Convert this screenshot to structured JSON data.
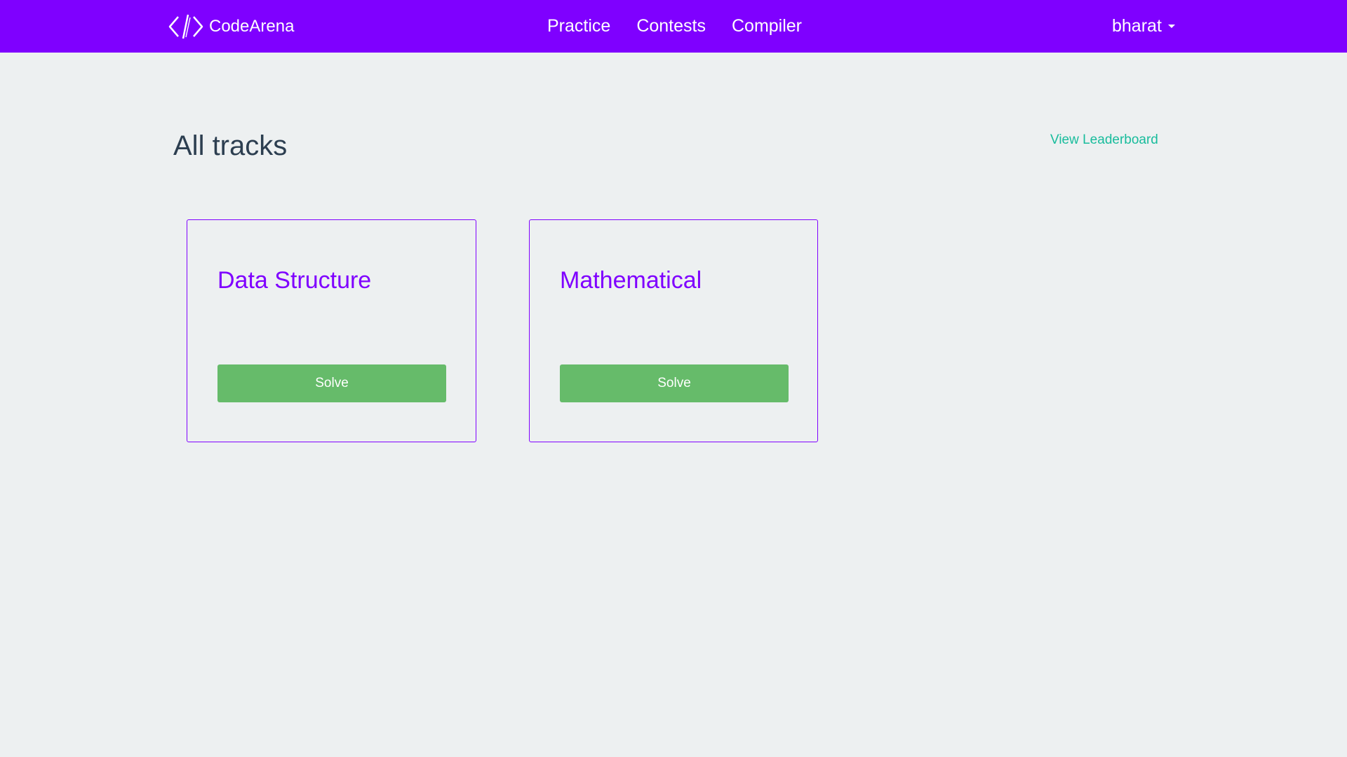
{
  "navbar": {
    "brand_icon": "code-brackets-icon",
    "brand_name": "CodeArena",
    "links": [
      "Practice",
      "Contests",
      "Compiler"
    ],
    "user": "bharat",
    "user_menu_icon": "caret-down-icon",
    "background_color": "#7f00ff"
  },
  "main": {
    "title": "All tracks",
    "leaderboard_link": "View Leaderboard",
    "tracks": [
      {
        "title": "Data Structure",
        "button": "Solve"
      },
      {
        "title": "Mathematical",
        "button": "Solve"
      }
    ]
  },
  "colors": {
    "accent": "#7f00ff",
    "success_button": "#66bb6a",
    "link": "#18bc9c",
    "heading": "#2c3e50",
    "background": "#edf0f1"
  }
}
